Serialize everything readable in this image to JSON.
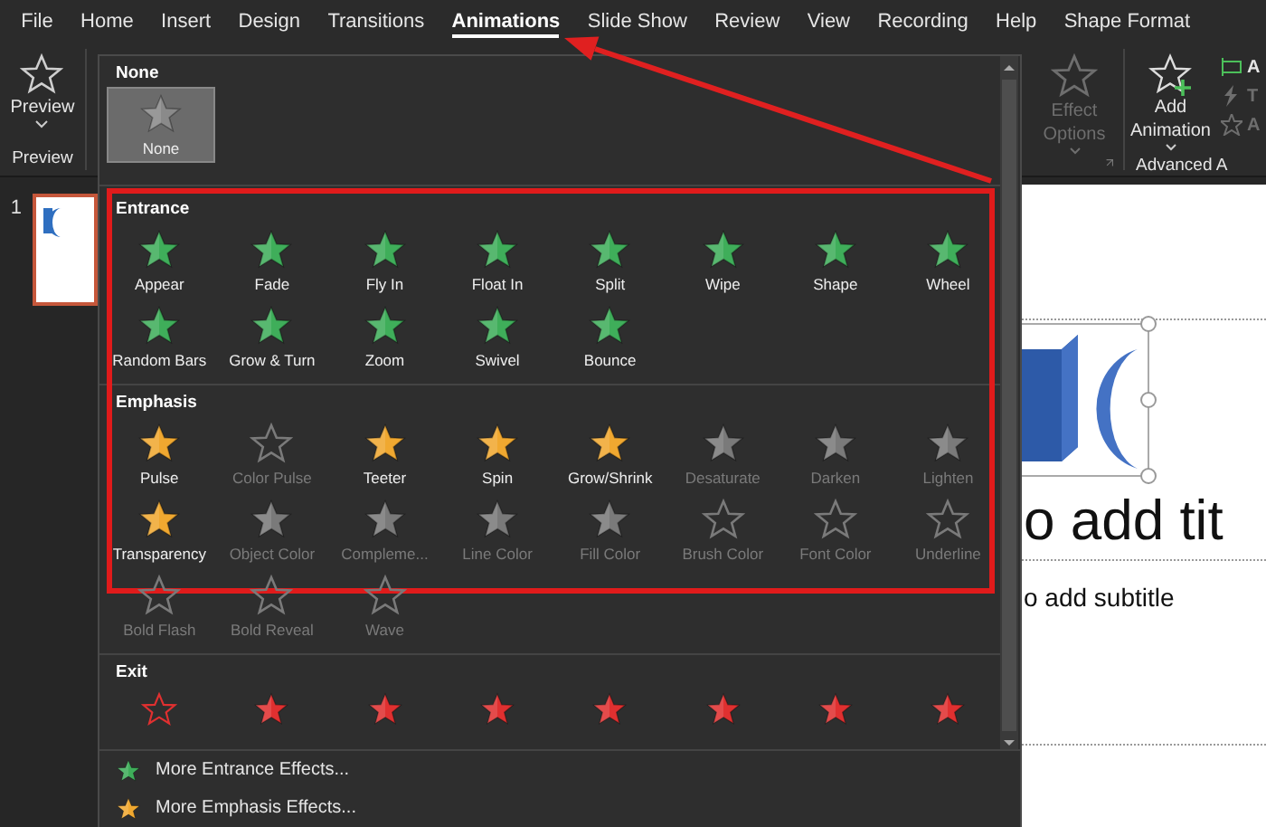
{
  "menu_tabs": [
    {
      "label": "File",
      "selected": false
    },
    {
      "label": "Home",
      "selected": false
    },
    {
      "label": "Insert",
      "selected": false
    },
    {
      "label": "Design",
      "selected": false
    },
    {
      "label": "Transitions",
      "selected": false
    },
    {
      "label": "Animations",
      "selected": true
    },
    {
      "label": "Slide Show",
      "selected": false
    },
    {
      "label": "Review",
      "selected": false
    },
    {
      "label": "View",
      "selected": false
    },
    {
      "label": "Recording",
      "selected": false
    },
    {
      "label": "Help",
      "selected": false
    },
    {
      "label": "Shape Format",
      "selected": false
    }
  ],
  "ribbon": {
    "preview": {
      "label": "Preview",
      "group": "Preview"
    },
    "effect_options": {
      "label_lines": [
        "Effect",
        "Options"
      ],
      "disabled": true
    },
    "add_animation": {
      "label_lines": [
        "Add",
        "Animation"
      ],
      "disabled": false
    },
    "advanced_group": "Advanced A",
    "side_items": [
      {
        "label": "A",
        "disabled": false
      },
      {
        "label": "T",
        "disabled": true
      },
      {
        "label": "A",
        "disabled": true
      }
    ]
  },
  "gallery": {
    "sections": [
      {
        "kind": "none",
        "title": "None",
        "items": [
          {
            "label": "None",
            "kind": "filled",
            "selected": true,
            "disabled": false
          }
        ]
      },
      {
        "kind": "entrance",
        "title": "Entrance",
        "items": [
          {
            "label": "Appear",
            "kind": "filled",
            "selected": false,
            "disabled": false
          },
          {
            "label": "Fade",
            "kind": "filled",
            "selected": false,
            "disabled": false
          },
          {
            "label": "Fly In",
            "kind": "filled",
            "selected": false,
            "disabled": false
          },
          {
            "label": "Float In",
            "kind": "filled",
            "selected": false,
            "disabled": false
          },
          {
            "label": "Split",
            "kind": "filled",
            "selected": false,
            "disabled": false
          },
          {
            "label": "Wipe",
            "kind": "filled",
            "selected": false,
            "disabled": false
          },
          {
            "label": "Shape",
            "kind": "filled",
            "selected": false,
            "disabled": false
          },
          {
            "label": "Wheel",
            "kind": "filled",
            "selected": false,
            "disabled": false
          },
          {
            "label": "Random Bars",
            "kind": "filled",
            "selected": false,
            "disabled": false
          },
          {
            "label": "Grow & Turn",
            "kind": "filled",
            "selected": false,
            "disabled": false
          },
          {
            "label": "Zoom",
            "kind": "filled",
            "selected": false,
            "disabled": false
          },
          {
            "label": "Swivel",
            "kind": "filled",
            "selected": false,
            "disabled": false
          },
          {
            "label": "Bounce",
            "kind": "filled",
            "selected": false,
            "disabled": false
          }
        ]
      },
      {
        "kind": "emphasis",
        "title": "Emphasis",
        "items": [
          {
            "label": "Pulse",
            "kind": "filled",
            "selected": false,
            "disabled": false
          },
          {
            "label": "Color Pulse",
            "kind": "outline",
            "selected": false,
            "disabled": true
          },
          {
            "label": "Teeter",
            "kind": "filled",
            "selected": false,
            "disabled": false
          },
          {
            "label": "Spin",
            "kind": "filled",
            "selected": false,
            "disabled": false
          },
          {
            "label": "Grow/Shrink",
            "kind": "filled",
            "selected": false,
            "disabled": false
          },
          {
            "label": "Desaturate",
            "kind": "filled",
            "selected": false,
            "disabled": true
          },
          {
            "label": "Darken",
            "kind": "filled",
            "selected": false,
            "disabled": true
          },
          {
            "label": "Lighten",
            "kind": "filled",
            "selected": false,
            "disabled": true
          },
          {
            "label": "Transparency",
            "kind": "filled",
            "selected": false,
            "disabled": false
          },
          {
            "label": "Object Color",
            "kind": "filled",
            "selected": false,
            "disabled": true
          },
          {
            "label": "Compleme...",
            "kind": "filled",
            "selected": false,
            "disabled": true
          },
          {
            "label": "Line Color",
            "kind": "filled",
            "selected": false,
            "disabled": true
          },
          {
            "label": "Fill Color",
            "kind": "filled",
            "selected": false,
            "disabled": true
          },
          {
            "label": "Brush Color",
            "kind": "outline",
            "selected": false,
            "disabled": true
          },
          {
            "label": "Font Color",
            "kind": "outline",
            "selected": false,
            "disabled": true
          },
          {
            "label": "Underline",
            "kind": "outline",
            "selected": false,
            "disabled": true
          },
          {
            "label": "Bold Flash",
            "kind": "outline",
            "selected": false,
            "disabled": true
          },
          {
            "label": "Bold Reveal",
            "kind": "outline",
            "selected": false,
            "disabled": true
          },
          {
            "label": "Wave",
            "kind": "outline",
            "selected": false,
            "disabled": true
          }
        ]
      },
      {
        "kind": "exit",
        "title": "Exit",
        "items": [
          {
            "kind": "outline",
            "selected": false,
            "disabled": false
          },
          {
            "kind": "filled",
            "selected": false,
            "disabled": false
          },
          {
            "kind": "filled",
            "selected": false,
            "disabled": false
          },
          {
            "kind": "filled",
            "selected": false,
            "disabled": false
          },
          {
            "kind": "filled",
            "selected": false,
            "disabled": false
          },
          {
            "kind": "filled",
            "selected": false,
            "disabled": false
          },
          {
            "kind": "filled",
            "selected": false,
            "disabled": false
          },
          {
            "kind": "filled",
            "selected": false,
            "disabled": false
          }
        ]
      }
    ],
    "more": [
      {
        "kind": "entrance",
        "label": "More Entrance Effects..."
      },
      {
        "kind": "emphasis",
        "label": "More Emphasis Effects..."
      }
    ]
  },
  "slides": [
    {
      "number": "1",
      "selected": true
    }
  ],
  "slide": {
    "title_text": "o add tit",
    "subtitle_text": "o add subtitle"
  }
}
